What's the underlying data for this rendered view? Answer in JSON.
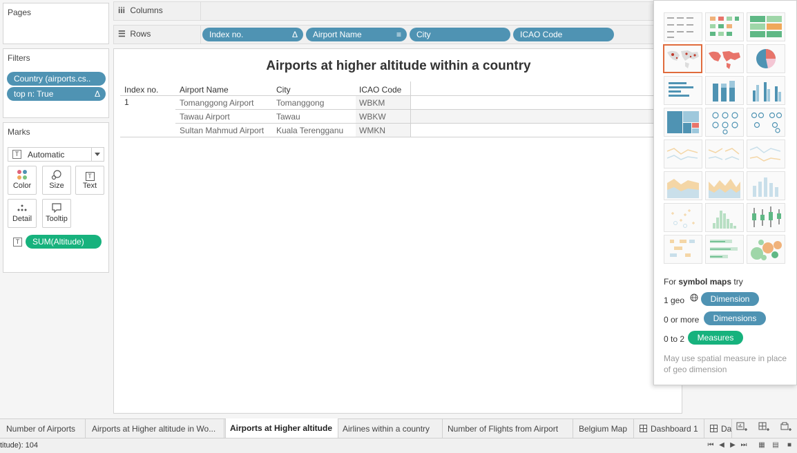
{
  "pages": {
    "title": "Pages"
  },
  "filters": {
    "title": "Filters",
    "items": [
      {
        "label": "Country (airports.cs..",
        "icon": ""
      },
      {
        "label": "top n: True",
        "icon": "Δ"
      }
    ]
  },
  "marks": {
    "title": "Marks",
    "type": "Automatic",
    "buttons": [
      {
        "label": "Color",
        "icon": "color-dots-icon"
      },
      {
        "label": "Size",
        "icon": "size-icon"
      },
      {
        "label": "Text",
        "icon": "text-icon"
      },
      {
        "label": "Detail",
        "icon": "detail-icon"
      },
      {
        "label": "Tooltip",
        "icon": "tooltip-icon"
      }
    ],
    "field": "SUM(Altitude)"
  },
  "shelves": {
    "columns_label": "Columns",
    "rows_label": "Rows",
    "rows": [
      {
        "label": "Index no.",
        "icon": "Δ"
      },
      {
        "label": "Airport Name",
        "icon": "≡"
      },
      {
        "label": "City",
        "icon": ""
      },
      {
        "label": "ICAO Code",
        "icon": ""
      }
    ]
  },
  "view": {
    "title": "Airports at higher altitude within a country",
    "headers": [
      "Index no.",
      "Airport Name",
      "City",
      "ICAO Code"
    ],
    "index": "1",
    "rows": [
      {
        "airport": "Tomanggong Airport",
        "city": "Tomanggong",
        "icao": "WBKM"
      },
      {
        "airport": "Tawau Airport",
        "city": "Tawau",
        "icao": "WBKW"
      },
      {
        "airport": "Sultan Mahmud Airport",
        "city": "Kuala Terengganu",
        "icao": "WMKN"
      }
    ]
  },
  "show_me": {
    "hint_prefix": "For ",
    "hint_bold": "symbol maps",
    "hint_suffix": " try",
    "req1_label": "1 geo",
    "req1_pill": "Dimension",
    "req2_label": "0 or more",
    "req2_pill": "Dimensions",
    "req3_label": "0 to 2",
    "req3_pill": "Measures",
    "note": "May use spatial measure in place of geo dimension"
  },
  "tabs": [
    {
      "label": "Number of Airports",
      "active": false
    },
    {
      "label": "Airports at Higher altitude in Wo...",
      "active": false
    },
    {
      "label": "Airports at Higher altitude",
      "active": true
    },
    {
      "label": "Airlines within a country",
      "active": false
    },
    {
      "label": "Number of Flights from Airport",
      "active": false
    },
    {
      "label": "Belgium Map",
      "active": false
    },
    {
      "label": "Dashboard 1",
      "active": false
    },
    {
      "label": "Da",
      "active": false
    }
  ],
  "status": {
    "text": "titude): 104"
  },
  "colors": {
    "dimension_pill": "#4f93b3",
    "measure_pill": "#17b27d",
    "selected_thumb": "#e06b3c"
  }
}
